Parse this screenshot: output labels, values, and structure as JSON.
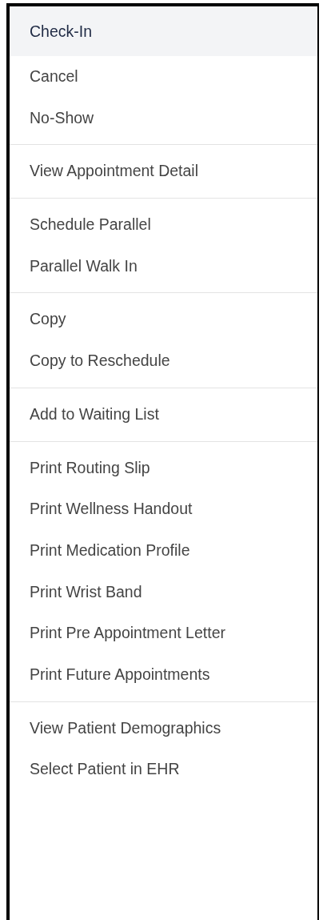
{
  "menu": {
    "groups": [
      {
        "items": [
          {
            "label": "Check-In",
            "selected": true
          },
          {
            "label": "Cancel",
            "selected": false
          },
          {
            "label": "No-Show",
            "selected": false
          }
        ]
      },
      {
        "items": [
          {
            "label": "View Appointment Detail",
            "selected": false
          }
        ]
      },
      {
        "items": [
          {
            "label": "Schedule Parallel",
            "selected": false
          },
          {
            "label": "Parallel Walk In",
            "selected": false
          }
        ]
      },
      {
        "items": [
          {
            "label": "Copy",
            "selected": false
          },
          {
            "label": "Copy to Reschedule",
            "selected": false
          }
        ]
      },
      {
        "items": [
          {
            "label": "Add to Waiting List",
            "selected": false
          }
        ]
      },
      {
        "items": [
          {
            "label": "Print Routing Slip",
            "selected": false
          },
          {
            "label": "Print Wellness Handout",
            "selected": false
          },
          {
            "label": "Print Medication Profile",
            "selected": false
          },
          {
            "label": "Print Wrist Band",
            "selected": false
          },
          {
            "label": "Print Pre Appointment Letter",
            "selected": false
          },
          {
            "label": "Print Future Appointments",
            "selected": false
          }
        ]
      },
      {
        "items": [
          {
            "label": "View Patient Demographics",
            "selected": false
          },
          {
            "label": "Select Patient in EHR",
            "selected": false
          }
        ]
      }
    ]
  }
}
